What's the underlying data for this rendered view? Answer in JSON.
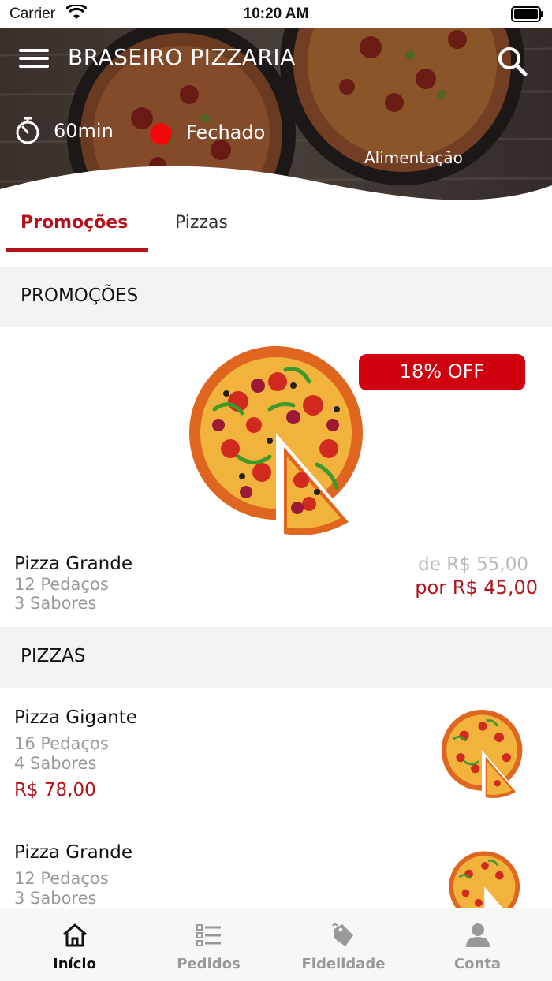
{
  "status_bar": {
    "carrier": "Carrier",
    "time": "10:20 AM"
  },
  "header": {
    "title": "BRASEIRO PIZZARIA",
    "delivery_time": "60min",
    "status": "Fechado",
    "status_color": "#f00a0a",
    "category": "Alimentação"
  },
  "tabs": [
    {
      "label": "Promoções",
      "active": true
    },
    {
      "label": "Pizzas",
      "active": false
    }
  ],
  "sections": {
    "promocoes": {
      "title": "PROMOÇÕES",
      "items": [
        {
          "name": "Pizza Grande",
          "detail1": "12 Pedaços",
          "detail2": "3 Sabores",
          "badge": "18% OFF",
          "old_price": "de R$ 55,00",
          "new_price": "por R$ 45,00"
        }
      ]
    },
    "pizzas": {
      "title": "PIZZAS",
      "items": [
        {
          "name": "Pizza Gigante",
          "detail1": "16 Pedaços",
          "detail2": "4 Sabores",
          "price": "R$ 78,00"
        },
        {
          "name": "Pizza Grande",
          "detail1": "12 Pedaços",
          "detail2": "3 Sabores"
        }
      ]
    }
  },
  "bottom_nav": [
    {
      "label": "Início",
      "icon": "home-icon",
      "active": true
    },
    {
      "label": "Pedidos",
      "icon": "orders-list-icon",
      "active": false
    },
    {
      "label": "Fidelidade",
      "icon": "loyalty-tag-icon",
      "active": false
    },
    {
      "label": "Conta",
      "icon": "account-icon",
      "active": false
    }
  ],
  "colors": {
    "accent": "#b3121a",
    "badge": "#d0000f"
  }
}
